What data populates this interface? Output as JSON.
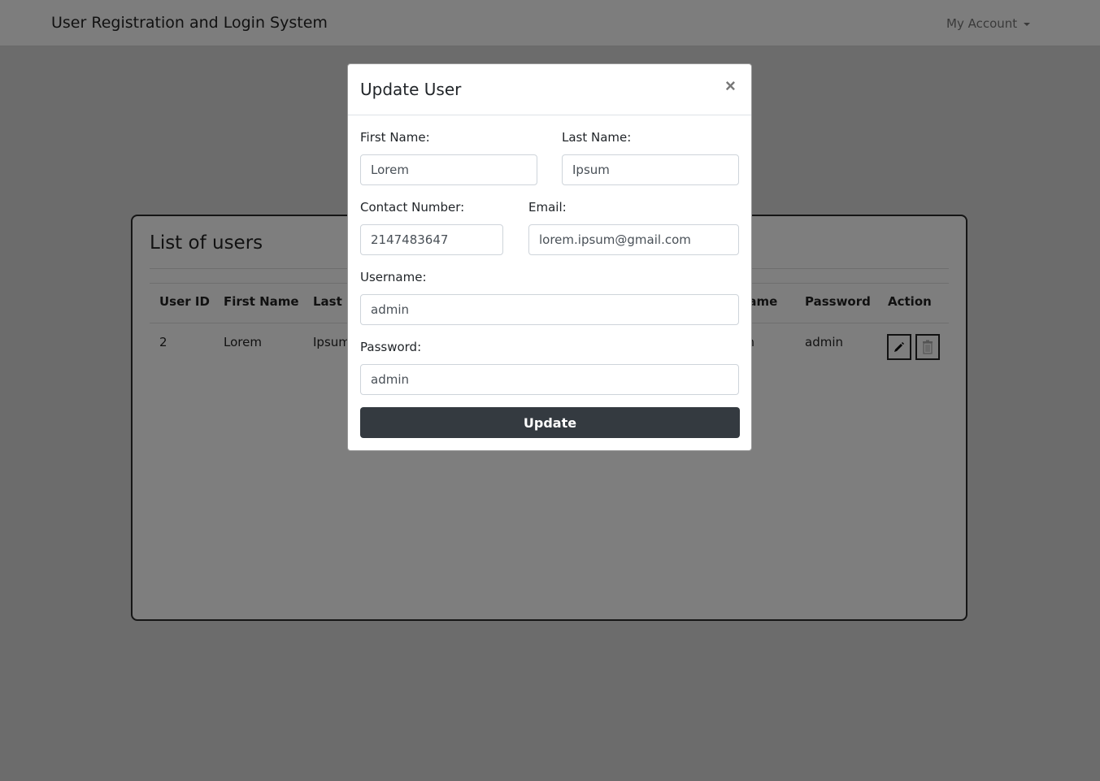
{
  "navbar": {
    "brand": "User Registration and Login System",
    "account_menu": "My Account"
  },
  "card": {
    "title": "List of users",
    "columns": [
      "User ID",
      "First Name",
      "Last Name",
      "Username",
      "Password",
      "Action"
    ],
    "rows": [
      {
        "user_id": "2",
        "first_name": "Lorem",
        "last_name": "Ipsum",
        "username": "admin",
        "password": "admin"
      }
    ]
  },
  "modal": {
    "title": "Update User",
    "close": "×",
    "fields": {
      "first_name": {
        "label": "First Name:",
        "value": "Lorem"
      },
      "last_name": {
        "label": "Last Name:",
        "value": "Ipsum"
      },
      "contact": {
        "label": "Contact Number:",
        "value": "2147483647"
      },
      "email": {
        "label": "Email:",
        "value": "lorem.ipsum@gmail.com"
      },
      "username": {
        "label": "Username:",
        "value": "admin"
      },
      "password": {
        "label": "Password:",
        "value": "admin"
      }
    },
    "submit": "Update"
  }
}
